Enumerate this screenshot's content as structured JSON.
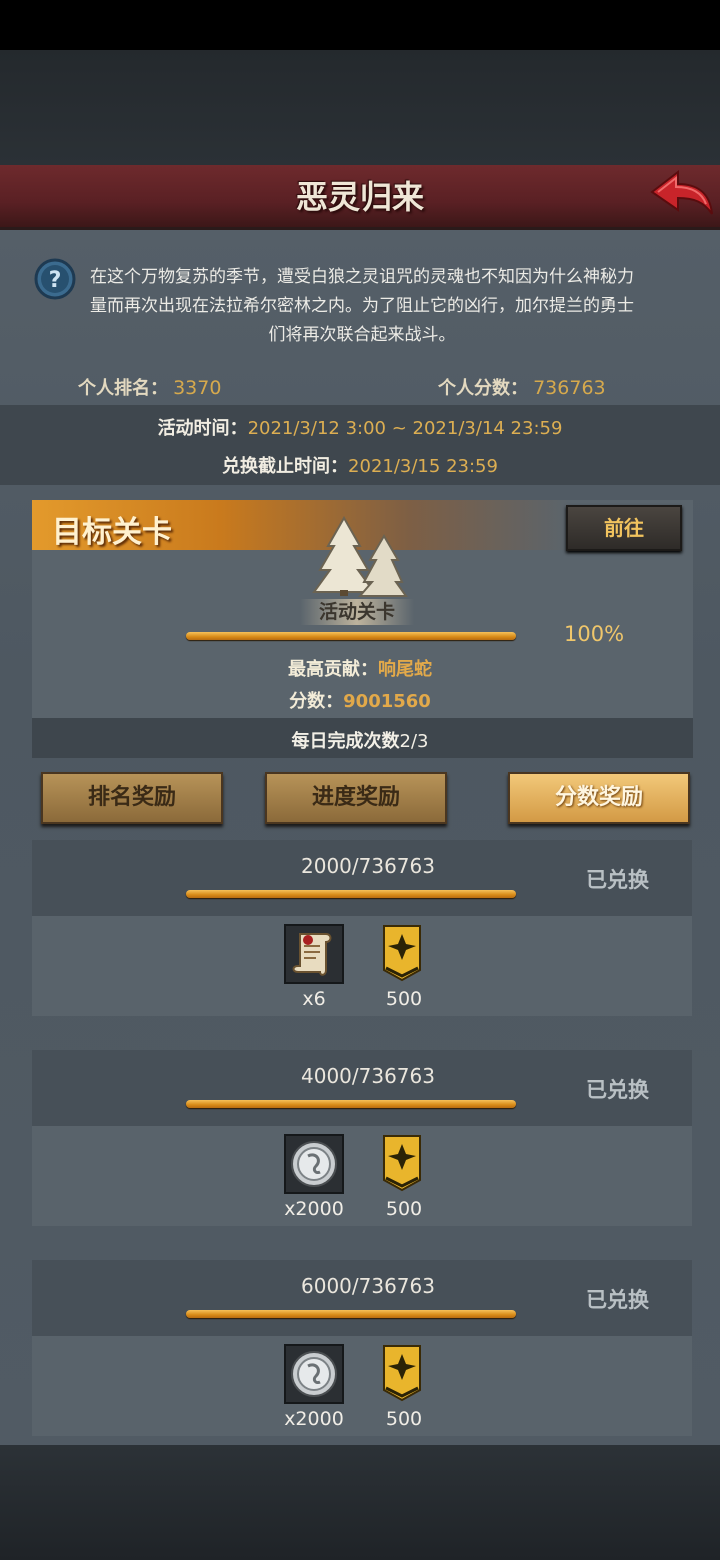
{
  "header": {
    "title": "恶灵归来",
    "back_icon": "red-back-arrow-icon"
  },
  "description": "在这个万物复苏的季节，遭受白狼之灵诅咒的灵魂也不知因为什么神秘力量而再次出现在法拉希尔密林之内。为了阻止它的凶行，加尔提兰的勇士们将再次联合起来战斗。",
  "stats": {
    "rank_label": "个人排名：",
    "rank_value": "3370",
    "score_label": "个人分数：",
    "score_value": "736763"
  },
  "times": {
    "event_label": "活动时间：",
    "event_value": "2021/3/12 3:00 ~ 2021/3/14 23:59",
    "deadline_label": "兑换截止时间：",
    "deadline_value": "2021/3/15 23:59"
  },
  "stage": {
    "header": "目标关卡",
    "go_button": "前往",
    "name": "活动关卡",
    "progress_text": "100%",
    "progress": 1.0,
    "top_contrib_label": "最高贡献：",
    "top_contrib_value": "响尾蛇",
    "score_label": "分数：",
    "score_value": "9001560",
    "daily_label": "每日完成次数",
    "daily_value": "2/3"
  },
  "tabs": [
    {
      "label": "排名奖励",
      "active": false
    },
    {
      "label": "进度奖励",
      "active": false
    },
    {
      "label": "分数奖励",
      "active": true
    }
  ],
  "rewards": [
    {
      "progress_text": "2000/736763",
      "status": "已兑换",
      "item_a": {
        "icon": "scroll-icon",
        "count": "x6"
      },
      "item_b": {
        "icon": "gold-rank-banner-icon",
        "count": "500"
      }
    },
    {
      "progress_text": "4000/736763",
      "status": "已兑换",
      "item_a": {
        "icon": "silver-coin-icon",
        "count": "x2000"
      },
      "item_b": {
        "icon": "gold-rank-banner-icon",
        "count": "500"
      }
    },
    {
      "progress_text": "6000/736763",
      "status": "已兑换",
      "item_a": {
        "icon": "silver-coin-icon",
        "count": "x2000"
      },
      "item_b": {
        "icon": "gold-rank-banner-icon",
        "count": "500"
      }
    }
  ],
  "colors": {
    "accent_gold": "#d6a94d",
    "banner_red": "#6e2a2d",
    "active_tab": "#f2c879"
  }
}
